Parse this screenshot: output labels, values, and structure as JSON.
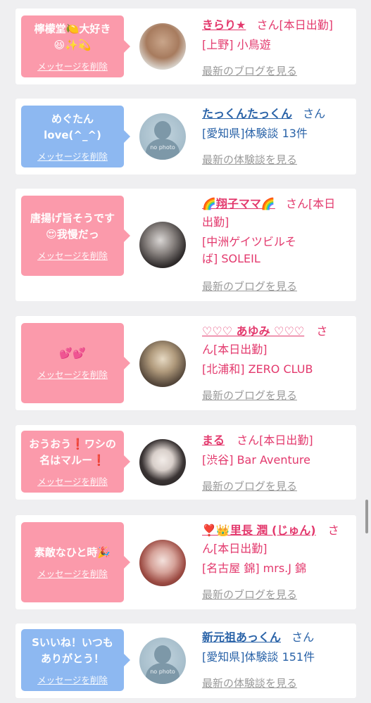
{
  "delete_label": "メッセージを削除",
  "colors": {
    "pink_bubble": "#fb9aab",
    "blue_bubble": "#8db8f1",
    "pink_text": "#e3396d",
    "blue_text": "#2a63a8"
  },
  "cards": [
    {
      "message_lines": [
        "檸檬堂🍋大好き",
        "😆✨💫"
      ],
      "name": "きらり★",
      "suffix_lines": [
        "さん[本日出勤]"
      ],
      "shop_lines": [
        "[上野] 小鳥遊"
      ],
      "link": "最新のブログを見る"
    },
    {
      "message_lines": [
        "めぐたん",
        "love(^_^)"
      ],
      "name": "たっくんたっくん",
      "suffix_lines": [
        "さん"
      ],
      "shop_lines": [
        "[愛知県]体験談 13件"
      ],
      "avatar_text": "no photo",
      "link": "最新の体験談を見る"
    },
    {
      "message_lines": [
        "唐揚げ旨そうです",
        "😍我慢だっ"
      ],
      "name": "🌈翔子ママ🌈",
      "suffix_lines": [
        "さん[本日",
        "出勤]"
      ],
      "shop_lines": [
        "[中洲ゲイツビルそ",
        "ば] SOLEIL"
      ],
      "link": "最新のブログを見る"
    },
    {
      "message_lines": [
        "💕💕"
      ],
      "name": "♡♡♡ あゆみ ♡♡♡",
      "suffix_lines": [
        "さ",
        "ん[本日出勤]"
      ],
      "shop_lines": [
        "[北浦和] ZERO CLUB"
      ],
      "link": "最新のブログを見る"
    },
    {
      "message_lines": [
        "おうおう❗ワシの",
        "名はマルー❗"
      ],
      "name": "まる",
      "suffix_lines": [
        "さん[本日出勤]"
      ],
      "shop_lines": [
        "[渋谷] Bar Aventure"
      ],
      "link": "最新のブログを見る"
    },
    {
      "message_lines": [
        "素敵なひと時🎉"
      ],
      "name": "❣️👑里長 潤 (じゅん)",
      "suffix_lines": [
        "さ",
        "ん[本日出勤]"
      ],
      "shop_lines": [
        "[名古屋 錦] mrs.J 錦"
      ],
      "link": "最新のブログを見る"
    },
    {
      "message_lines": [
        "Sいいね！いつも",
        "ありがとう！"
      ],
      "name": "新元祖あっくん",
      "suffix_lines": [
        "さん"
      ],
      "shop_lines": [
        "[愛知県]体験談 151件"
      ],
      "avatar_text": "no photo",
      "link": "最新の体験談を見る"
    }
  ]
}
